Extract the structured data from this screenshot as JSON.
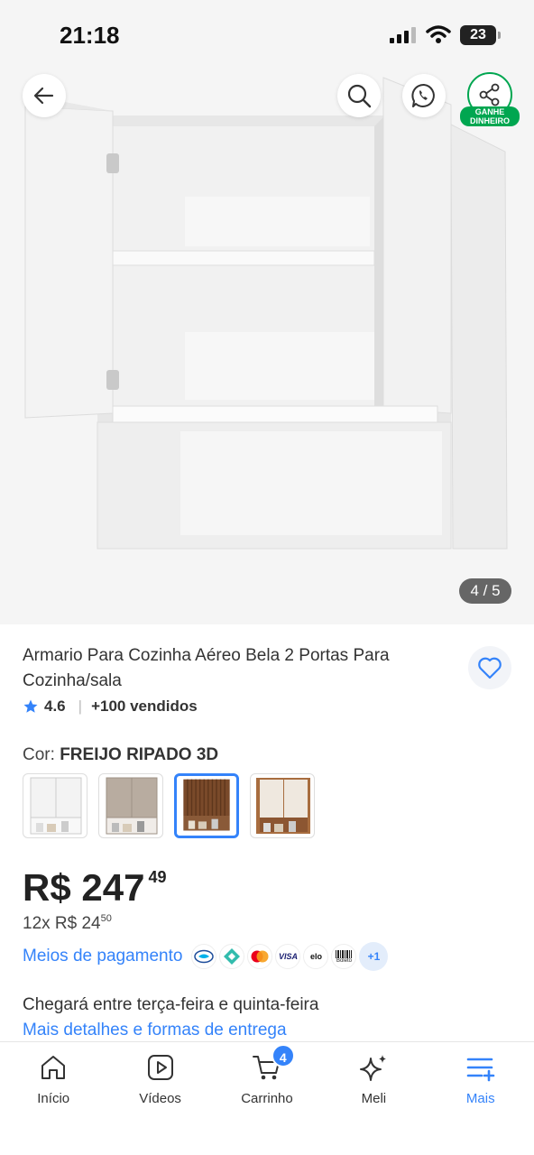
{
  "status_bar": {
    "time": "21:18",
    "battery": "23"
  },
  "gallery": {
    "counter": "4 / 5",
    "share_badge": "GANHE DINHEIRO"
  },
  "product": {
    "title": "Armario Para Cozinha Aéreo Bela 2 Portas Para Cozinha/sala",
    "rating": "4.6",
    "sold": "+100 vendidos",
    "variant_label": "Cor:",
    "variant_value": "FREIJO RIPADO 3D",
    "swatches": [
      {
        "name": "white",
        "color": "#f3f3f3"
      },
      {
        "name": "taupe",
        "color": "#b8aca0"
      },
      {
        "name": "freijo-ripado",
        "color": "#7a4a2a",
        "selected": true
      },
      {
        "name": "off-white-wood",
        "color": "#efe8df"
      }
    ],
    "price_currency": "R$",
    "price_int": "247",
    "price_cents": "49",
    "installments": "12x R$ 24",
    "installment_cents": "50"
  },
  "payment": {
    "link": "Meios de pagamento",
    "methods": [
      "mercado-pago-icon",
      "pix-icon",
      "mastercard-icon",
      "VISA",
      "elo",
      "Boleto"
    ],
    "more": "+1"
  },
  "delivery": {
    "text": "Chegará entre terça-feira e quinta-feira",
    "link": "Mais detalhes e formas de entrega"
  },
  "tabbar": {
    "items": [
      {
        "label": "Início",
        "icon": "home-icon"
      },
      {
        "label": "Vídeos",
        "icon": "play-icon"
      },
      {
        "label": "Carrinho",
        "icon": "cart-icon",
        "badge": "4"
      },
      {
        "label": "Meli",
        "icon": "sparkle-icon"
      },
      {
        "label": "Mais",
        "icon": "menu-plus-icon",
        "active": true
      }
    ]
  },
  "colors": {
    "accent": "#3483fa",
    "green": "#00a650"
  }
}
